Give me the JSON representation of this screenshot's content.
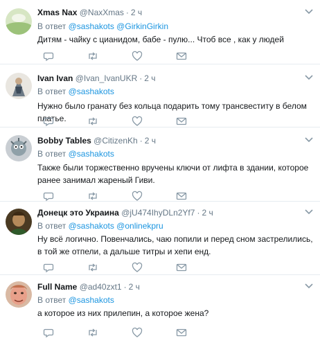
{
  "tweets": [
    {
      "name": "Xmas Nax",
      "handle": "@NaxXmas",
      "time": "2 ч",
      "reply_prefix": "В ответ",
      "mentions": [
        "@sashakots",
        "@GirkinGirkin"
      ],
      "text": "Дитям  - чайку с цианидом, бабе - пулю... Чтоб все , как у людей"
    },
    {
      "name": "Ivan Ivan",
      "handle": "@Ivan_IvanUKR",
      "time": "2 ч",
      "reply_prefix": "В ответ",
      "mentions": [
        "@sashakots"
      ],
      "text": "Нужно было гранату без кольца подарить тому трансвеститу в белом платье."
    },
    {
      "name": "Bobby Tables",
      "handle": "@CitizenKh",
      "time": "2 ч",
      "reply_prefix": "В ответ",
      "mentions": [
        "@sashakots"
      ],
      "text": "Также были торжественно вручены ключи от лифта в здании, которое ранее занимал жареный Гиви."
    },
    {
      "name": "Донецк это Украина",
      "handle": "@jU474IhyDLn2Yf7",
      "time": "2 ч",
      "reply_prefix": "В ответ",
      "mentions": [
        "@sashakots",
        "@onlinekpru"
      ],
      "text": "Ну всё логично. Повенчались, чаю попили и перед сном застрелились, в той же отпели, а дальше титры и  хепи енд."
    },
    {
      "name": "Full Name",
      "handle": "@ad40zxt1",
      "time": "2 ч",
      "reply_prefix": "В ответ",
      "mentions": [
        "@sashakots"
      ],
      "text": "а которое из них прилепин, а которое жена?"
    }
  ],
  "icons": {
    "reply": "reply-icon",
    "retweet": "retweet-icon",
    "like": "heart-icon",
    "dm": "envelope-icon",
    "more": "chevron-down-icon"
  },
  "colors": {
    "name": "#14171a",
    "secondary": "#657786",
    "mention": "#1b95e0",
    "icon": "#8899a6",
    "divider": "#e6ecf0"
  }
}
